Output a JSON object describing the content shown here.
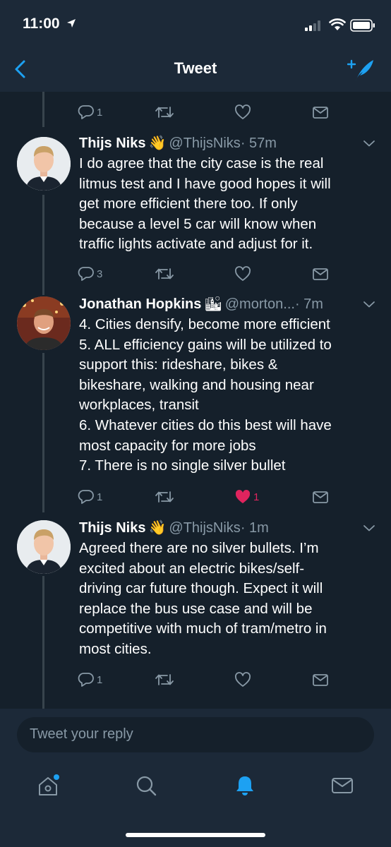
{
  "status_bar": {
    "time": "11:00"
  },
  "header": {
    "title": "Tweet"
  },
  "top_actions": {
    "reply_count": "1"
  },
  "tweets": [
    {
      "name": "Thijs Niks",
      "emoji": "👋",
      "handle": "@ThijsNiks",
      "time": "· 57m",
      "lines": [
        "I do agree that the city case is the real",
        "litmus test and I have good hopes it will",
        "get more efficient there too. If only",
        "because a level 5 car will know when",
        "traffic lights activate and adjust for it."
      ],
      "reply_count": "3",
      "like_count": "",
      "liked": false
    },
    {
      "name": "Jonathan Hopkins",
      "emoji": "🏙",
      "handle": "@morton...",
      "time": "· 7m",
      "lines": [
        "4. Cities densify, become more efficient",
        "5. ALL efficiency gains will be utilized to",
        "support this: rideshare, bikes &",
        "bikeshare, walking and housing near",
        "workplaces, transit",
        "6. Whatever cities do this best will have",
        "most capacity for more jobs",
        "7. There is no single silver bullet"
      ],
      "reply_count": "1",
      "like_count": "1",
      "liked": true
    },
    {
      "name": "Thijs Niks",
      "emoji": "👋",
      "handle": "@ThijsNiks",
      "time": "· 1m",
      "lines": [
        "Agreed there are no silver bullets. I’m",
        "excited about an electric bikes/self-",
        "driving car future though. Expect it will",
        "replace the bus use case and will be",
        "competitive with much of tram/metro in",
        "most cities."
      ],
      "reply_count": "1",
      "like_count": "",
      "liked": false
    }
  ],
  "reply_box": {
    "placeholder": "Tweet your reply"
  },
  "tab_bar": {
    "icons": [
      "home-icon",
      "search-icon",
      "notifications-icon",
      "messages-icon"
    ],
    "active": "notifications-icon"
  },
  "colors": {
    "background": "#15202b",
    "bar": "#1c2938",
    "accent": "#1da1f2",
    "muted": "#8899a6",
    "like": "#e0245e"
  }
}
